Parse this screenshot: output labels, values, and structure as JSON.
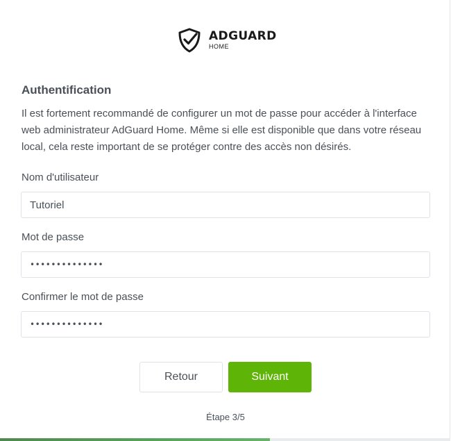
{
  "logo": {
    "name": "ADGUARD",
    "sub": "HOME"
  },
  "title": "Authentification",
  "description": "Il est fortement recommandé de configurer un mot de passe pour accéder à l'interface web administrateur AdGuard Home. Même si elle est disponible que dans votre réseau local, cela reste important de se protéger contre des accès non désirés.",
  "fields": {
    "username": {
      "label": "Nom d'utilisateur",
      "value": "Tutoriel"
    },
    "password": {
      "label": "Mot de passe",
      "value": "••••••••••••••"
    },
    "confirm": {
      "label": "Confirmer le mot de passe",
      "value": "••••••••••••••"
    }
  },
  "buttons": {
    "back": "Retour",
    "next": "Suivant"
  },
  "step": {
    "label": "Étape 3/5",
    "progress": 0.6
  },
  "colors": {
    "accent": "#5fb507",
    "progress": "#58a45a"
  }
}
